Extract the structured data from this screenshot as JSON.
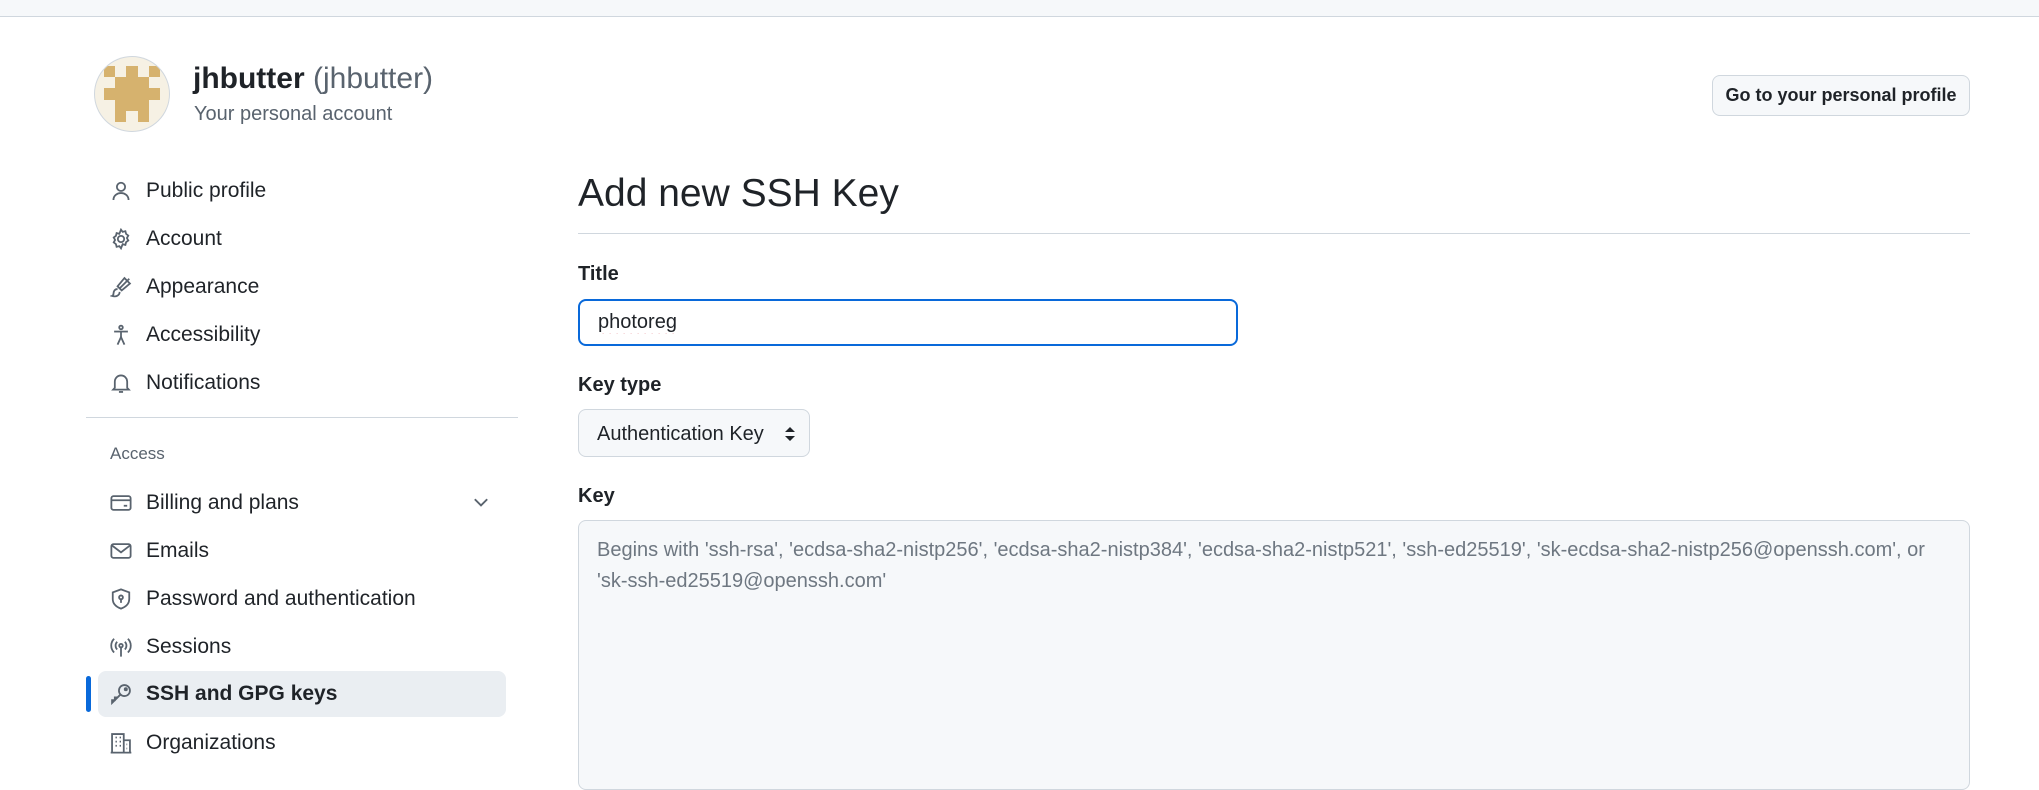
{
  "header": {
    "username": "jhbutter",
    "handle": "(jhbutter)",
    "subtitle": "Your personal account",
    "profile_button": "Go to your personal profile",
    "avatar_color": "#d6b26e"
  },
  "sidebar": {
    "items": [
      {
        "label": "Public profile",
        "icon": "person-icon"
      },
      {
        "label": "Account",
        "icon": "gear-icon"
      },
      {
        "label": "Appearance",
        "icon": "paintbrush-icon"
      },
      {
        "label": "Accessibility",
        "icon": "accessibility-icon"
      },
      {
        "label": "Notifications",
        "icon": "bell-icon"
      }
    ],
    "access_heading": "Access",
    "access_items": [
      {
        "label": "Billing and plans",
        "icon": "credit-card-icon",
        "expandable": true
      },
      {
        "label": "Emails",
        "icon": "mail-icon"
      },
      {
        "label": "Password and authentication",
        "icon": "shield-icon"
      },
      {
        "label": "Sessions",
        "icon": "broadcast-icon"
      },
      {
        "label": "SSH and GPG keys",
        "icon": "key-icon",
        "active": true
      },
      {
        "label": "Organizations",
        "icon": "organization-icon"
      }
    ],
    "active_color": "#0969da"
  },
  "main": {
    "title": "Add new SSH Key",
    "title_label": "Title",
    "title_value": "photoreg",
    "key_type_label": "Key type",
    "key_type_value": "Authentication Key",
    "key_label": "Key",
    "key_placeholder": "Begins with 'ssh-rsa', 'ecdsa-sha2-nistp256', 'ecdsa-sha2-nistp384', 'ecdsa-sha2-nistp521', 'ssh-ed25519', 'sk-ecdsa-sha2-nistp256@openssh.com', or 'sk-ssh-ed25519@openssh.com'",
    "focus_color": "#0969da"
  }
}
